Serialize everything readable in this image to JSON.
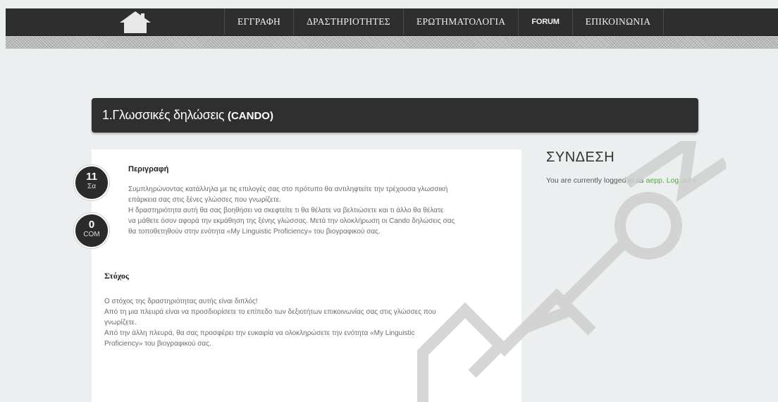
{
  "nav": {
    "items": [
      {
        "label": "ΕΓΓΡΑΦΗ"
      },
      {
        "label": "ΔΡΑΣΤΗΡΙΟΤΗΤΕΣ"
      },
      {
        "label": "ΕΡΩΤΗΜΑΤΟΛΟΓΙΑ"
      },
      {
        "label": "FORUM"
      },
      {
        "label": "ΕΠΙΚΟΙΝΩΝΙΑ"
      }
    ]
  },
  "page": {
    "title_main": "1.Γλωσσικές δηλώσεις ",
    "title_bold": "(CANDO)"
  },
  "post": {
    "day": "11",
    "day_label": "Σα",
    "comments": "0",
    "comments_label": "COM",
    "description_heading": "Περιγραφή",
    "description_lines": [
      "Συμπληρώνοντας κατάλληλα με τις επιλογές σας στο πρότυπο θα αντιληφτείτε την  τρέχουσα γλωσσική",
      "επάρκεια σας στις ξένες  γλώσσες που γνωρίζετε.",
      "Η δραστηριότητα αυτή θα  σας βοηθήσει να σκεφτείτε  τι θα θέλατε να βελτιώσετε και τι άλλο θα θέλατε",
      "να μάθετε όσον αφορά την εκμάθηση της ξένης γλώσσας. Μετά την ολοκλήρωση οι Cando δηλώσεις σας",
      "θα τοποθετηθούν  στην ενότητα «My Linguistic Proficiency» του βιογραφικού σας."
    ],
    "goal_heading": "Στόχος",
    "goal_lines": [
      "Ο στόχος της δραστηριότητας αυτής είναι διπλός!",
      "Από τη μια πλευρά είναι να προσδιορίσετε το επίπεδο των δεξιοτήτων επικοινωνίας σας στις γλώσσες που",
      "γνωρίζετε.",
      "Από την άλλη πλευρά, θα σας προσφέρει την ευκαιρία να ολοκληρώσετε  την ενότητα «My Linguistic",
      "Proficiency» του βιογραφικού σας."
    ]
  },
  "sidebar": {
    "title": "ΣΥΝΔΕΣΗ",
    "logged_prefix": "You are currently logged in as ",
    "username": "aepp",
    "logged_sep": ". ",
    "logout_label": "Log out »"
  },
  "colors": {
    "nav_bg": "#2e2e2e",
    "link": "#56a83d",
    "watermark": "#d0d0d0"
  }
}
